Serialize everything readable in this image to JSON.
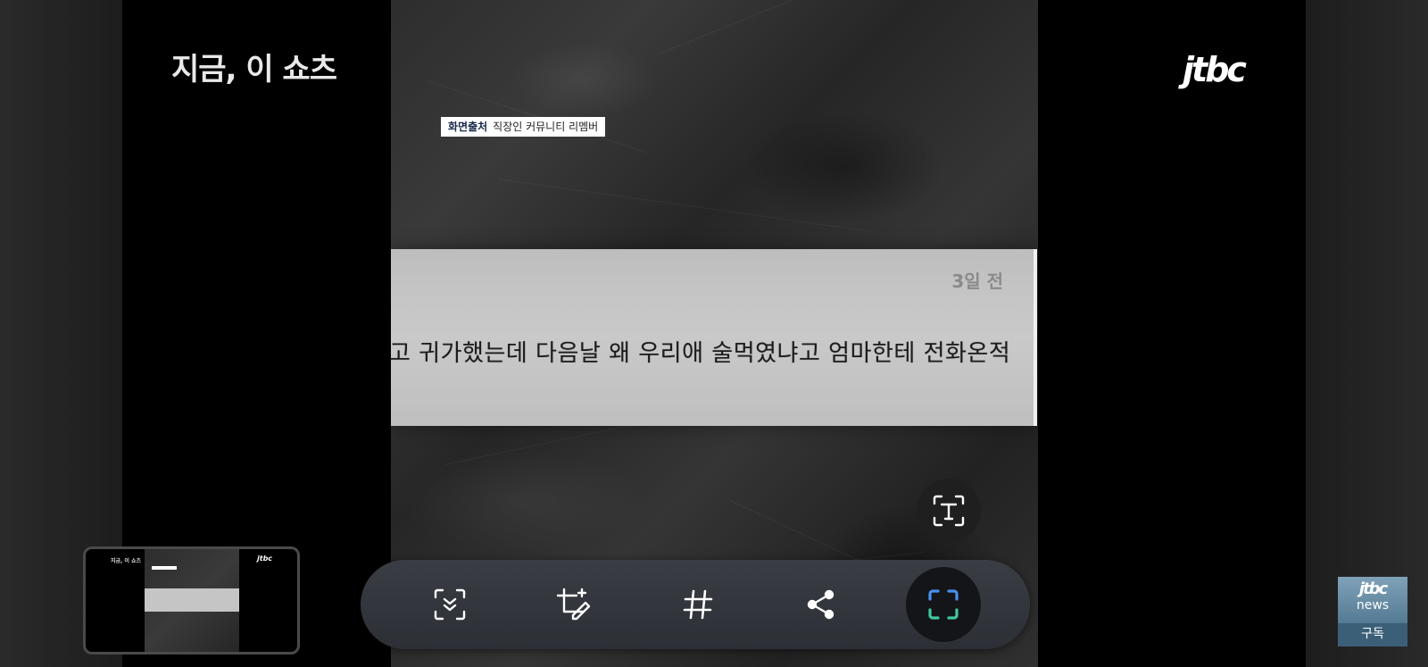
{
  "video": {
    "show_title": "지금, 이 쇼츠",
    "channel_logo": "jtbc",
    "source_label": "화면출처",
    "source_text": "직장인 커뮤니티 리멤버",
    "post": {
      "time": "3일 전",
      "text": "고 귀가했는데 다음날 왜 우리애 술먹였냐고 엄마한테 전화온적"
    }
  },
  "text_scan_button": {
    "icon": "text-scan-icon"
  },
  "toolbar": {
    "tools": [
      {
        "name": "scroll-capture",
        "icon": "scroll-capture-icon"
      },
      {
        "name": "draw-edit",
        "icon": "crop-edit-icon"
      },
      {
        "name": "tags",
        "icon": "hashtag-icon"
      },
      {
        "name": "share",
        "icon": "share-icon"
      },
      {
        "name": "smart-select",
        "icon": "smart-select-icon"
      }
    ]
  },
  "thumbnail": {
    "show_title": "지금, 이 쇼츠",
    "channel_logo": "jtbc"
  },
  "subscribe": {
    "logo": "jtbc",
    "logo_sub": "news",
    "label": "구독"
  },
  "colors": {
    "toolbar_bg": "#33363c",
    "accent_blue": "#4a8ff0",
    "accent_green": "#3ec9a0",
    "subscribe_bg": "#3c5f78"
  }
}
